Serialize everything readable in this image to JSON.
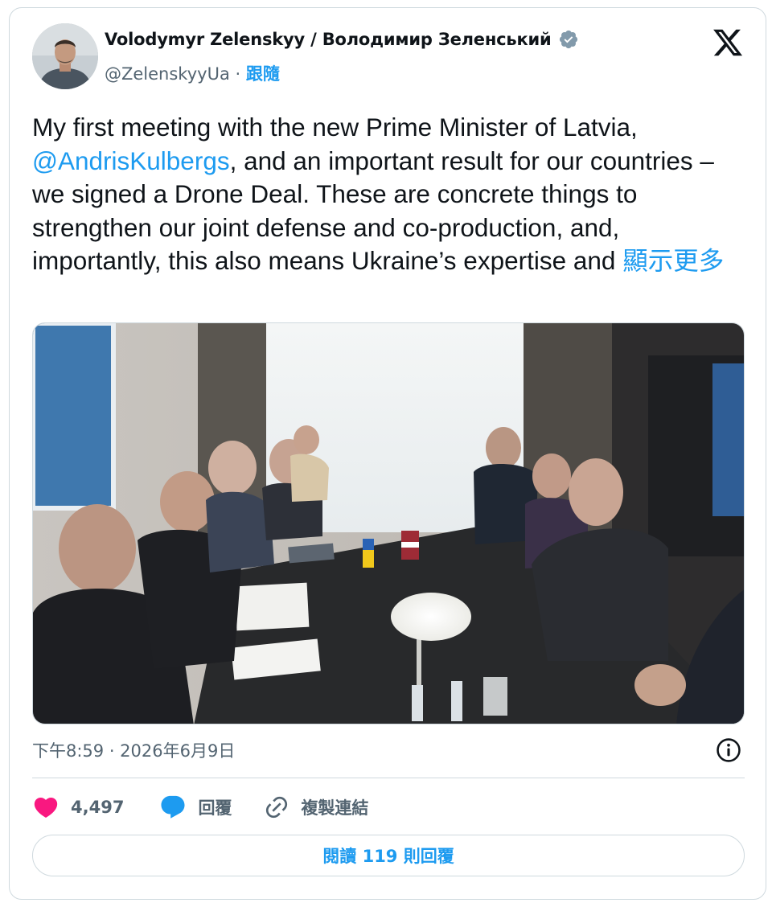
{
  "author": {
    "name": "Volodymyr Zelenskyy / Володимир Зеленський",
    "handle": "@ZelenskyyUa",
    "separator": "·",
    "follow_label": "跟隨",
    "verified": true
  },
  "tweet": {
    "text_before_mention": "My first meeting with the new Prime Minister of Latvia, ",
    "mention": "@AndrisKulbergs",
    "text_after_mention": ", and an important result for our countries – we signed a Drone Deal. These are concrete things to strengthen our joint defense and co-production, and, importantly, this also means Ukraine’s expertise and ",
    "show_more_label": "顯示更多"
  },
  "meta": {
    "timestamp": "下午8:59 · 2026年6月9日"
  },
  "actions": {
    "likes_count": "4,497",
    "reply_label": "回覆",
    "copy_link_label": "複製連結"
  },
  "read_replies_label": "閱讀 119 則回覆",
  "colors": {
    "accent": "#1d9bf0",
    "like": "#f91880",
    "text": "#0f1419",
    "secondary": "#536471",
    "border": "#cfd9de"
  }
}
